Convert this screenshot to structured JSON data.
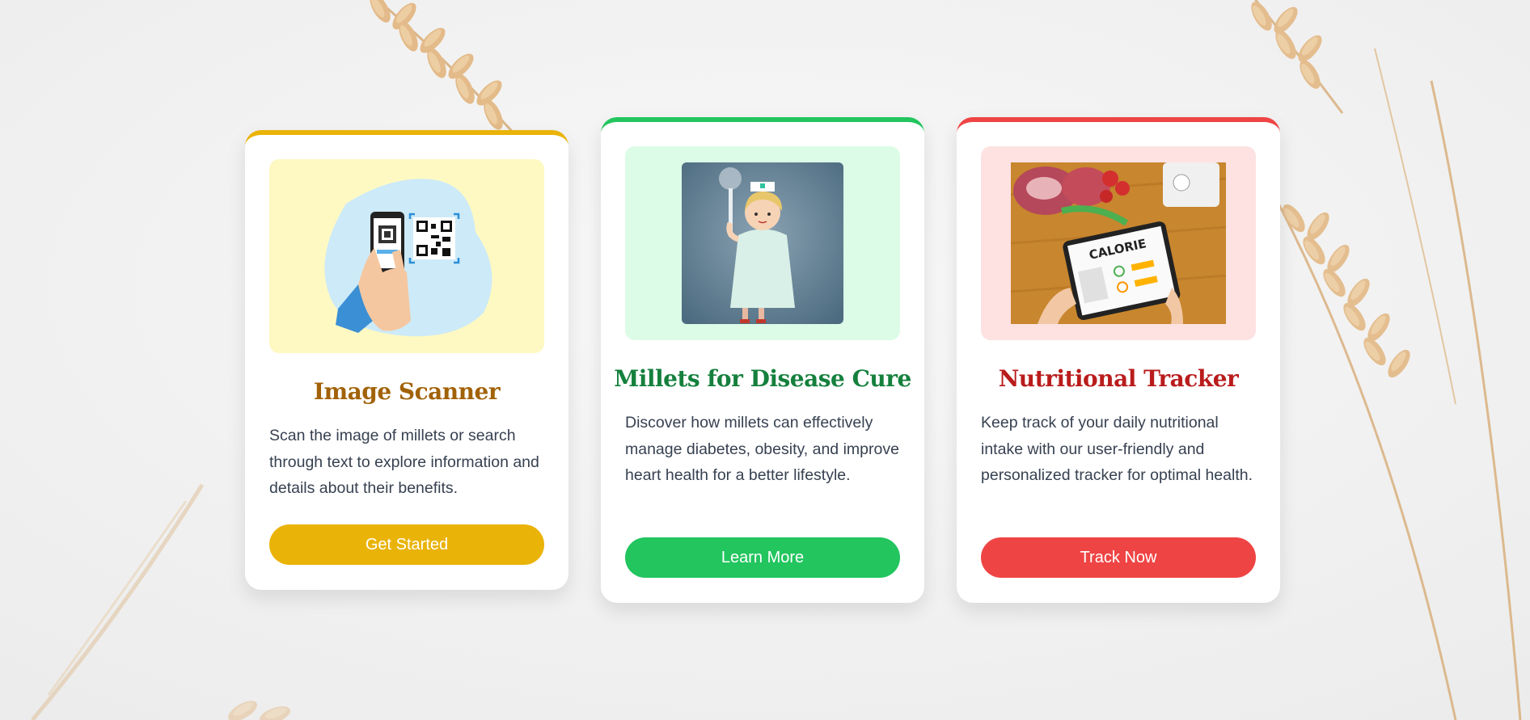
{
  "colors": {
    "page_bg": "#f3f3f3",
    "scanner_accent": "#eab308",
    "disease_accent": "#22c55e",
    "tracker_accent": "#ef4444"
  },
  "cards": [
    {
      "title": "Image Scanner",
      "description": "Scan the image of millets or search through text to explore information and details about their benefits.",
      "button_label": "Get Started",
      "image_icon": "qr-scanner-illustration",
      "title_color": "#a16207",
      "image_bg": "#fef9c3"
    },
    {
      "title": "Millets for Disease Cure",
      "description": "Discover how millets can effectively manage diabetes, obesity, and improve heart health for a better lifestyle.",
      "button_label": "Learn More",
      "image_icon": "nurse-illustration",
      "title_color": "#15803d",
      "image_bg": "#dcfce7"
    },
    {
      "title": "Nutritional Tracker",
      "description": "Keep track of your daily nutritional intake with our user-friendly and personalized tracker for optimal health.",
      "button_label": "Track Now",
      "image_icon": "calorie-counter-tablet-illustration",
      "title_color": "#b91c1c",
      "image_bg": "#fee2e2",
      "image_text": "CALORIE"
    }
  ]
}
